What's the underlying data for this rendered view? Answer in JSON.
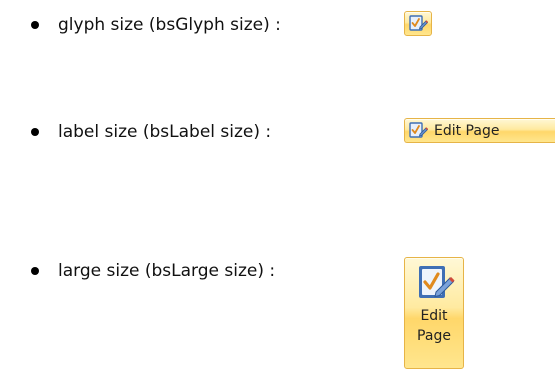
{
  "items": [
    {
      "text": "glyph size (bsGlyph size) :",
      "button": {
        "style": "glyph",
        "icon": "edit-page-icon"
      }
    },
    {
      "text": "label size (bsLabel size) :",
      "button": {
        "style": "label",
        "icon": "edit-page-icon",
        "caption": "Edit Page"
      }
    },
    {
      "text": "large size (bsLarge size) :",
      "button": {
        "style": "large",
        "icon": "edit-page-icon",
        "caption_line1": "Edit",
        "caption_line2": "Page"
      }
    }
  ],
  "colors": {
    "button_border": "#e6b447",
    "button_fill_top": "#fff8d6",
    "button_fill_bottom": "#ffd76a",
    "icon_blue": "#3f6fb5",
    "check_orange": "#e08a1e"
  }
}
